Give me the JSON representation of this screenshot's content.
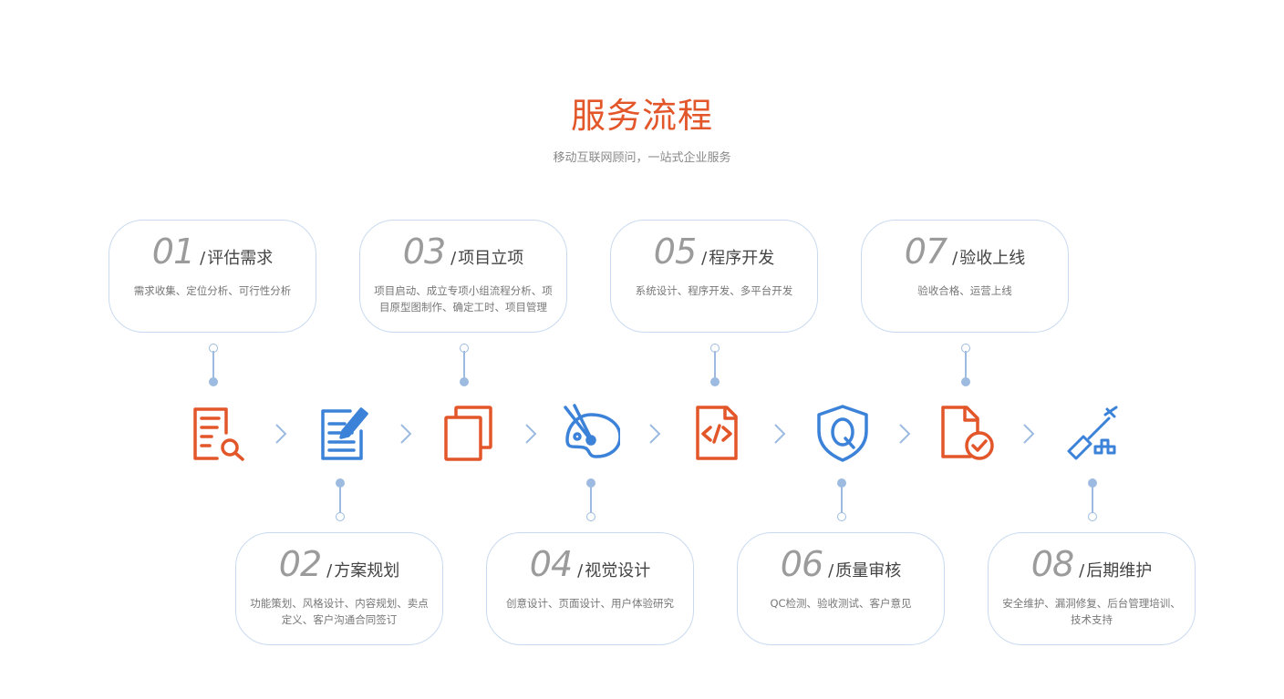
{
  "header": {
    "title": "服务流程",
    "subtitle": "移动互联网顾问，一站式企业服务"
  },
  "steps": [
    {
      "num": "01",
      "sep": "/",
      "name": "评估需求",
      "desc": "需求收集、定位分析、可行性分析",
      "icon": "document-search-icon",
      "color": "#e2562a"
    },
    {
      "num": "02",
      "sep": "/",
      "name": "方案规划",
      "desc": "功能策划、风格设计、内容规划、卖点定义、客户沟通合同签订",
      "icon": "edit-document-icon",
      "color": "#3b82d8"
    },
    {
      "num": "03",
      "sep": "/",
      "name": "项目立项",
      "desc": "项目启动、成立专项小组流程分析、项目原型图制作、确定工时、项目管理",
      "icon": "copy-pages-icon",
      "color": "#e2562a"
    },
    {
      "num": "04",
      "sep": "/",
      "name": "视觉设计",
      "desc": "创意设计、页面设计、用户体验研究",
      "icon": "palette-icon",
      "color": "#3b82d8"
    },
    {
      "num": "05",
      "sep": "/",
      "name": "程序开发",
      "desc": "系统设计、程序开发、多平台开发",
      "icon": "code-file-icon",
      "color": "#e2562a"
    },
    {
      "num": "06",
      "sep": "/",
      "name": "质量审核",
      "desc": "QC检测、验收测试、客户意见",
      "icon": "shield-q-icon",
      "color": "#3b82d8"
    },
    {
      "num": "07",
      "sep": "/",
      "name": "验收上线",
      "desc": "验收合格、运营上线",
      "icon": "file-check-icon",
      "color": "#e2562a"
    },
    {
      "num": "08",
      "sep": "/",
      "name": "后期维护",
      "desc": "安全维护、漏洞修复、后台管理培训、技术支持",
      "icon": "screwdriver-icon",
      "color": "#3b82d8"
    }
  ],
  "colors": {
    "accent_orange": "#e2562a",
    "accent_blue": "#3b82d8",
    "connector": "#9dbbe0",
    "card_border": "#c9daf0"
  }
}
